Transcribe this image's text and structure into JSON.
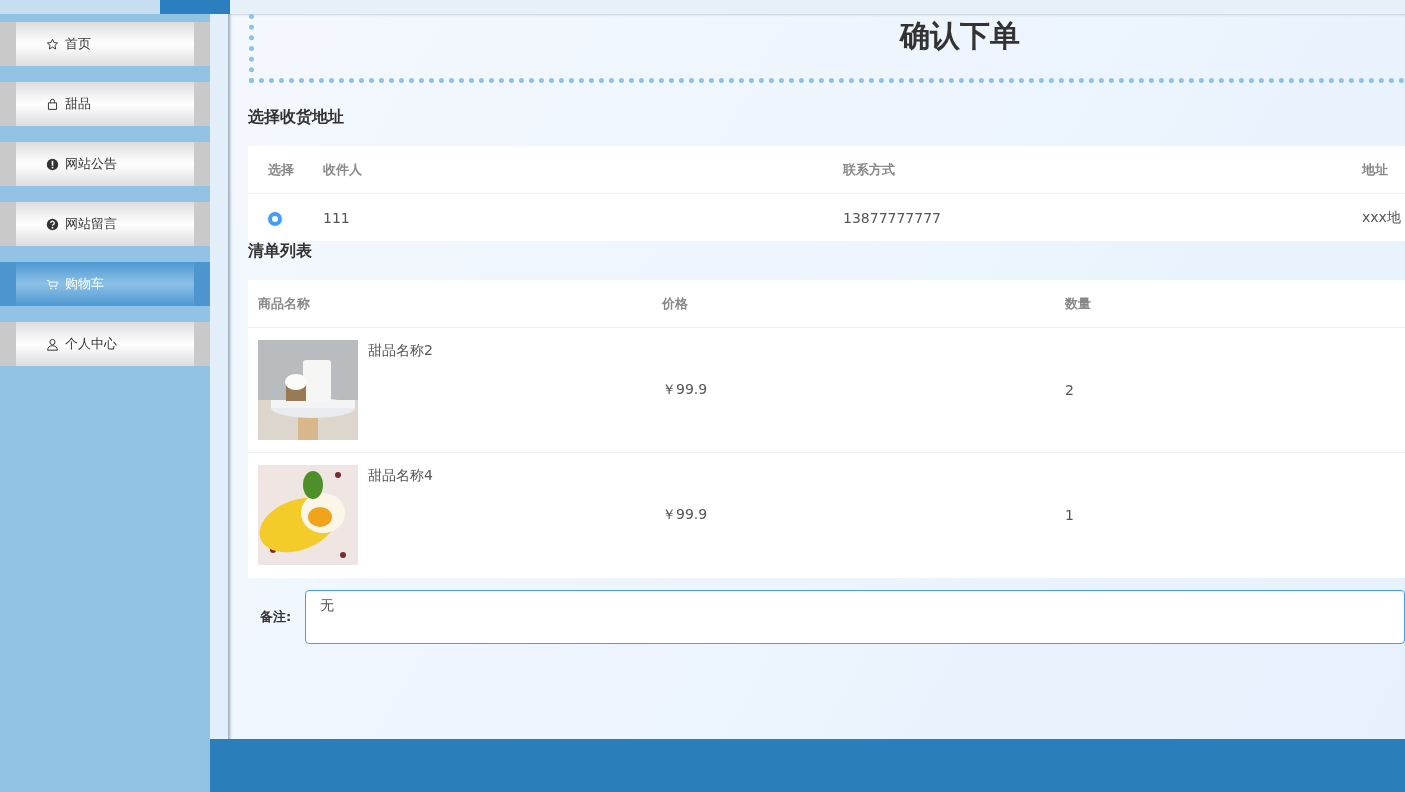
{
  "sidebar": {
    "items": [
      {
        "label": "首页",
        "selected": false
      },
      {
        "label": "甜品",
        "selected": false
      },
      {
        "label": "网站公告",
        "selected": false
      },
      {
        "label": "网站留言",
        "selected": false
      },
      {
        "label": "购物车",
        "selected": true
      },
      {
        "label": "个人中心",
        "selected": false
      }
    ]
  },
  "title": "确认下单",
  "address_section": {
    "heading": "选择收货地址",
    "columns": [
      "选择",
      "收件人",
      "联系方式",
      "地址"
    ],
    "rows": [
      {
        "selected": true,
        "recipient": "111",
        "phone": "13877777777",
        "address": "xxx地"
      }
    ]
  },
  "list_section": {
    "heading": "清单列表",
    "columns": [
      "商品名称",
      "价格",
      "数量"
    ],
    "rows": [
      {
        "name": "甜品名称2",
        "price": "￥99.9",
        "quantity": "2"
      },
      {
        "name": "甜品名称4",
        "price": "￥99.9",
        "quantity": "1"
      }
    ]
  },
  "remark": {
    "label": "备注:",
    "value": "无"
  }
}
